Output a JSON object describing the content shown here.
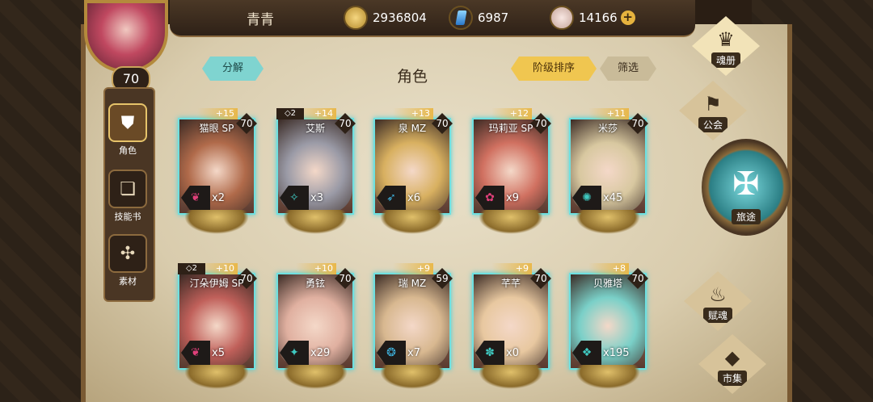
{
  "player": {
    "name": "青青",
    "level": "70"
  },
  "resources": {
    "gold": "2936804",
    "crystal": "6987",
    "gem": "14166",
    "add": "+"
  },
  "header": {
    "title": "角色",
    "decompose": "分解",
    "sort": "阶级排序",
    "filter": "筛选"
  },
  "left_menu": [
    {
      "label": "角色",
      "icon": "armor-icon",
      "glyph": "⛊"
    },
    {
      "label": "技能书",
      "icon": "book-icon",
      "glyph": "❏"
    },
    {
      "label": "素材",
      "icon": "material-icon",
      "glyph": "✣"
    }
  ],
  "right_menu": {
    "soulbook": "魂册",
    "guild": "公会",
    "journey": "旅途",
    "talent": "赋魂",
    "market": "市集"
  },
  "cards": [
    {
      "name": "猫眼 SP",
      "level": "70",
      "stars": "+15",
      "rank": "",
      "count": "x2",
      "elem_color": "#e0407a",
      "glyph": "❦",
      "tone": "#b06a4a"
    },
    {
      "name": "艾斯",
      "level": "70",
      "stars": "+14",
      "rank": "◇2",
      "count": "x3",
      "elem_color": "#3fc8c0",
      "glyph": "✧",
      "tone": "#9a9aa6"
    },
    {
      "name": "泉 MZ",
      "level": "70",
      "stars": "+13",
      "rank": "",
      "count": "x6",
      "elem_color": "#3fb4e0",
      "glyph": "➶",
      "tone": "#d8b060"
    },
    {
      "name": "玛莉亚 SP",
      "level": "70",
      "stars": "+12",
      "rank": "",
      "count": "x9",
      "elem_color": "#e0407a",
      "glyph": "✿",
      "tone": "#d07060"
    },
    {
      "name": "米莎",
      "level": "70",
      "stars": "+11",
      "rank": "",
      "count": "x45",
      "elem_color": "#3fc8c0",
      "glyph": "✺",
      "tone": "#d8c8a0"
    },
    {
      "name": "汀朵伊姆 SP",
      "level": "70",
      "stars": "+10",
      "rank": "◇2",
      "count": "x5",
      "elem_color": "#e0407a",
      "glyph": "❦",
      "tone": "#c0605a"
    },
    {
      "name": "勇铉",
      "level": "70",
      "stars": "+10",
      "rank": "",
      "count": "x29",
      "elem_color": "#3fc8c0",
      "glyph": "✦",
      "tone": "#e0b0a0"
    },
    {
      "name": "瑞 MZ",
      "level": "59",
      "stars": "+9",
      "rank": "",
      "count": "x7",
      "elem_color": "#3fb4e0",
      "glyph": "❂",
      "tone": "#d8b890"
    },
    {
      "name": "芊芊",
      "level": "70",
      "stars": "+9",
      "rank": "",
      "count": "x0",
      "elem_color": "#3fc8c0",
      "glyph": "✽",
      "tone": "#e8c8a0"
    },
    {
      "name": "贝雅塔",
      "level": "70",
      "stars": "+8",
      "rank": "",
      "count": "x195",
      "elem_color": "#3fc8c0",
      "glyph": "❖",
      "tone": "#7ad0c8"
    }
  ]
}
